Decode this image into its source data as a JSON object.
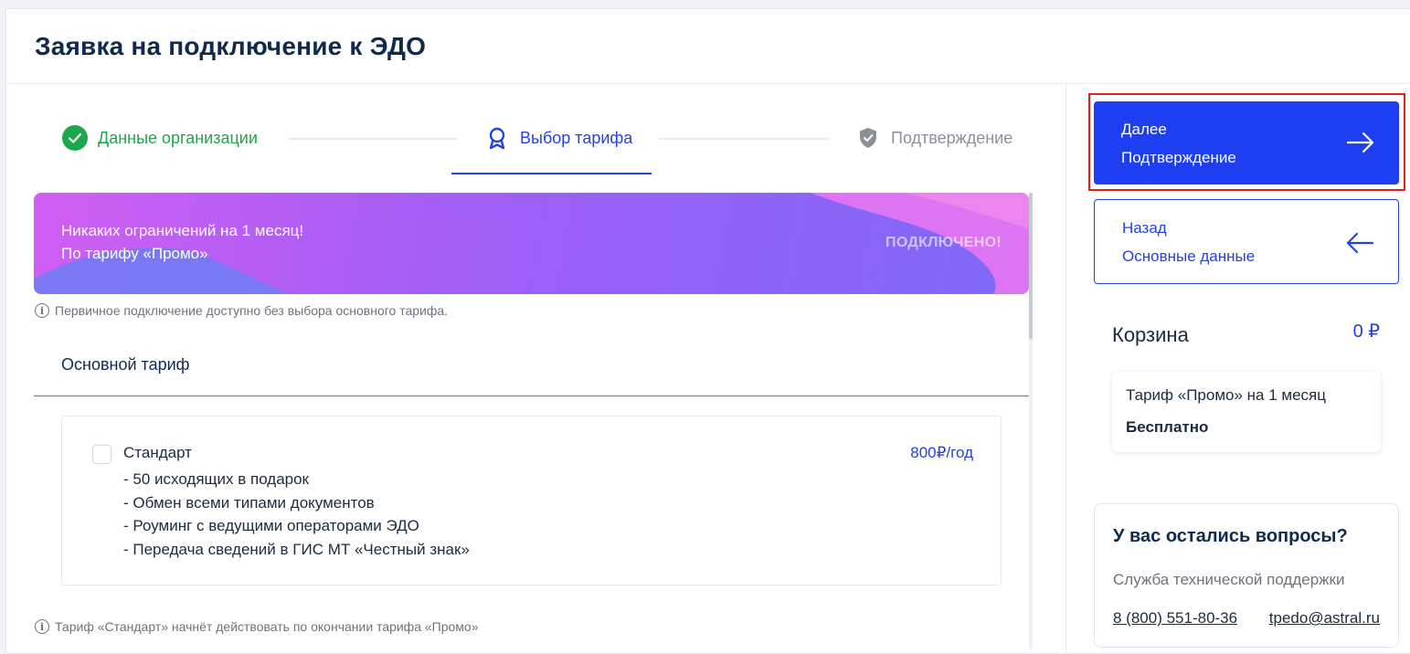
{
  "header": {
    "title": "Заявка на подключение к ЭДО"
  },
  "stepper": {
    "steps": [
      {
        "label": "Данные организации",
        "state": "done",
        "icon": "check-circle-icon"
      },
      {
        "label": "Выбор тарифа",
        "state": "active",
        "icon": "award-icon"
      },
      {
        "label": "Подтверждение",
        "state": "pending",
        "icon": "shield-check-icon"
      }
    ]
  },
  "banner": {
    "line1": "Никаких ограничений на 1 месяц!",
    "line2": "По тарифу «Промо»",
    "badge": "ПОДКЛЮЧЕНО!"
  },
  "notes": {
    "primary": "Первичное подключение доступно без выбора основного тарифа.",
    "standard": "Тариф «Стандарт» начнёт действовать по окончании тарифа «Промо»"
  },
  "main_tariff": {
    "section_title": "Основной тариф",
    "items": [
      {
        "name": "Стандарт",
        "price": "800₽/год",
        "checked": false,
        "features": [
          "- 50 исходящих в подарок",
          "- Обмен всеми типами документов",
          "- Роуминг с ведущими операторами ЭДО",
          "- Передача сведений в ГИС МТ «Честный знак»"
        ]
      }
    ]
  },
  "sidebar": {
    "next": {
      "line1": "Далее",
      "line2": "Подтверждение"
    },
    "back": {
      "line1": "Назад",
      "line2": "Основные данные"
    },
    "cart": {
      "title": "Корзина",
      "total": "0 ₽",
      "item_name": "Тариф «Промо» на 1 месяц",
      "item_price": "Бесплатно"
    },
    "help": {
      "question": "У вас остались вопросы?",
      "subtitle": "Служба технической поддержки",
      "phone": "8 (800) 551-80-36",
      "email": "tpedo@astral.ru"
    }
  },
  "colors": {
    "accent": "#2541e0",
    "success": "#1aa84b",
    "highlight_frame": "#e0201f"
  }
}
